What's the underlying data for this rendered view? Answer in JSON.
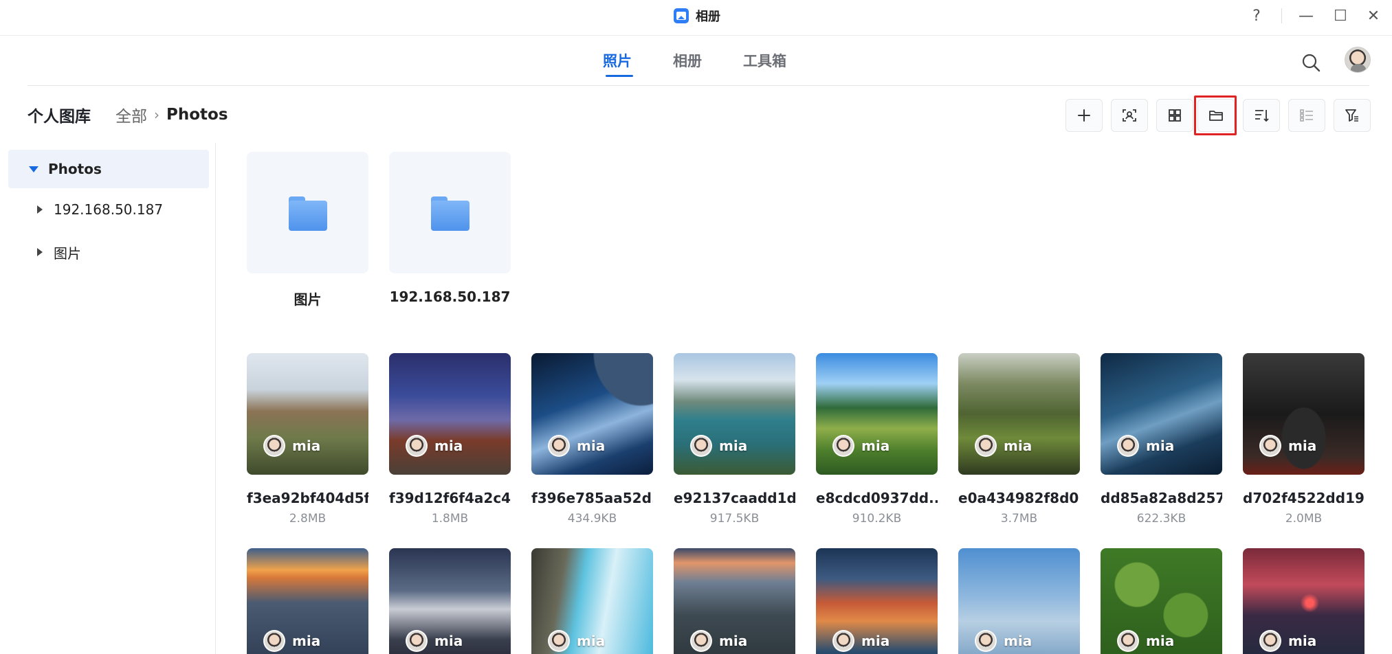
{
  "window": {
    "title": "相册",
    "controls": [
      "?",
      "—",
      "☐",
      "✕"
    ]
  },
  "nav": {
    "tabs": [
      {
        "label": "照片",
        "active": true
      },
      {
        "label": "相册",
        "active": false
      },
      {
        "label": "工具箱",
        "active": false
      }
    ]
  },
  "header": {
    "section_title": "个人图库",
    "breadcrumb_root": "全部",
    "breadcrumb_sep": "›",
    "breadcrumb_current": "Photos"
  },
  "toolbar": {
    "buttons": [
      "add-icon",
      "face-scan-icon",
      "grid-view-icon",
      "folder-view-icon",
      "sort-icon",
      "list-view-icon",
      "filter-icon"
    ],
    "highlighted": "folder-view-icon"
  },
  "sidebar": {
    "items": [
      {
        "label": "Photos",
        "expanded": true,
        "selected": true
      },
      {
        "label": "192.168.50.187",
        "expanded": false
      },
      {
        "label": "图片",
        "expanded": false
      }
    ]
  },
  "folders": [
    {
      "name": "图片"
    },
    {
      "name": "192.168.50.187"
    }
  ],
  "photos": [
    {
      "name": "f3ea92bf404d5f...",
      "size": "2.8MB",
      "owner": "mia"
    },
    {
      "name": "f39d12f6f4a2c4...",
      "size": "1.8MB",
      "owner": "mia"
    },
    {
      "name": "f396e785aa52d...",
      "size": "434.9KB",
      "owner": "mia"
    },
    {
      "name": "e92137caadd1d...",
      "size": "917.5KB",
      "owner": "mia"
    },
    {
      "name": "e8cdcd0937dd...",
      "size": "910.2KB",
      "owner": "mia"
    },
    {
      "name": "e0a434982f8d0...",
      "size": "3.7MB",
      "owner": "mia"
    },
    {
      "name": "dd85a82a8d257...",
      "size": "622.3KB",
      "owner": "mia"
    },
    {
      "name": "d702f4522dd19...",
      "size": "2.0MB",
      "owner": "mia"
    },
    {
      "owner": "mia"
    },
    {
      "owner": "mia"
    },
    {
      "owner": "mia"
    },
    {
      "owner": "mia"
    },
    {
      "owner": "mia"
    },
    {
      "owner": "mia"
    },
    {
      "owner": "mia"
    },
    {
      "owner": "mia"
    }
  ],
  "colors": {
    "accent": "#1769e0",
    "highlight_box": "#e02222"
  }
}
